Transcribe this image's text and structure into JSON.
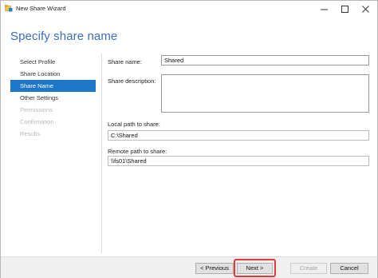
{
  "window": {
    "title": "New Share Wizard",
    "controls": [
      "minimize",
      "maximize",
      "close"
    ]
  },
  "header": {
    "title": "Specify share name"
  },
  "nav": {
    "items": [
      {
        "label": "Select Profile",
        "state": "normal"
      },
      {
        "label": "Share Location",
        "state": "normal"
      },
      {
        "label": "Share Name",
        "state": "active"
      },
      {
        "label": "Other Settings",
        "state": "normal"
      },
      {
        "label": "Permissions",
        "state": "disabled"
      },
      {
        "label": "Confirmation",
        "state": "disabled"
      },
      {
        "label": "Results",
        "state": "disabled"
      }
    ]
  },
  "form": {
    "share_name_label": "Share name:",
    "share_name_value": "Shared",
    "share_description_label": "Share description:",
    "share_description_value": "",
    "local_path_label": "Local path to share:",
    "local_path_value": "C:\\Shared",
    "remote_path_label": "Remote path to share:",
    "remote_path_value": "\\\\fs01\\Shared"
  },
  "buttons": {
    "previous": "< Previous",
    "next": "Next >",
    "create": "Create",
    "cancel": "Cancel"
  },
  "colors": {
    "accent": "#1e76c9",
    "title": "#3d6fb3",
    "highlight": "#e03a3a"
  }
}
